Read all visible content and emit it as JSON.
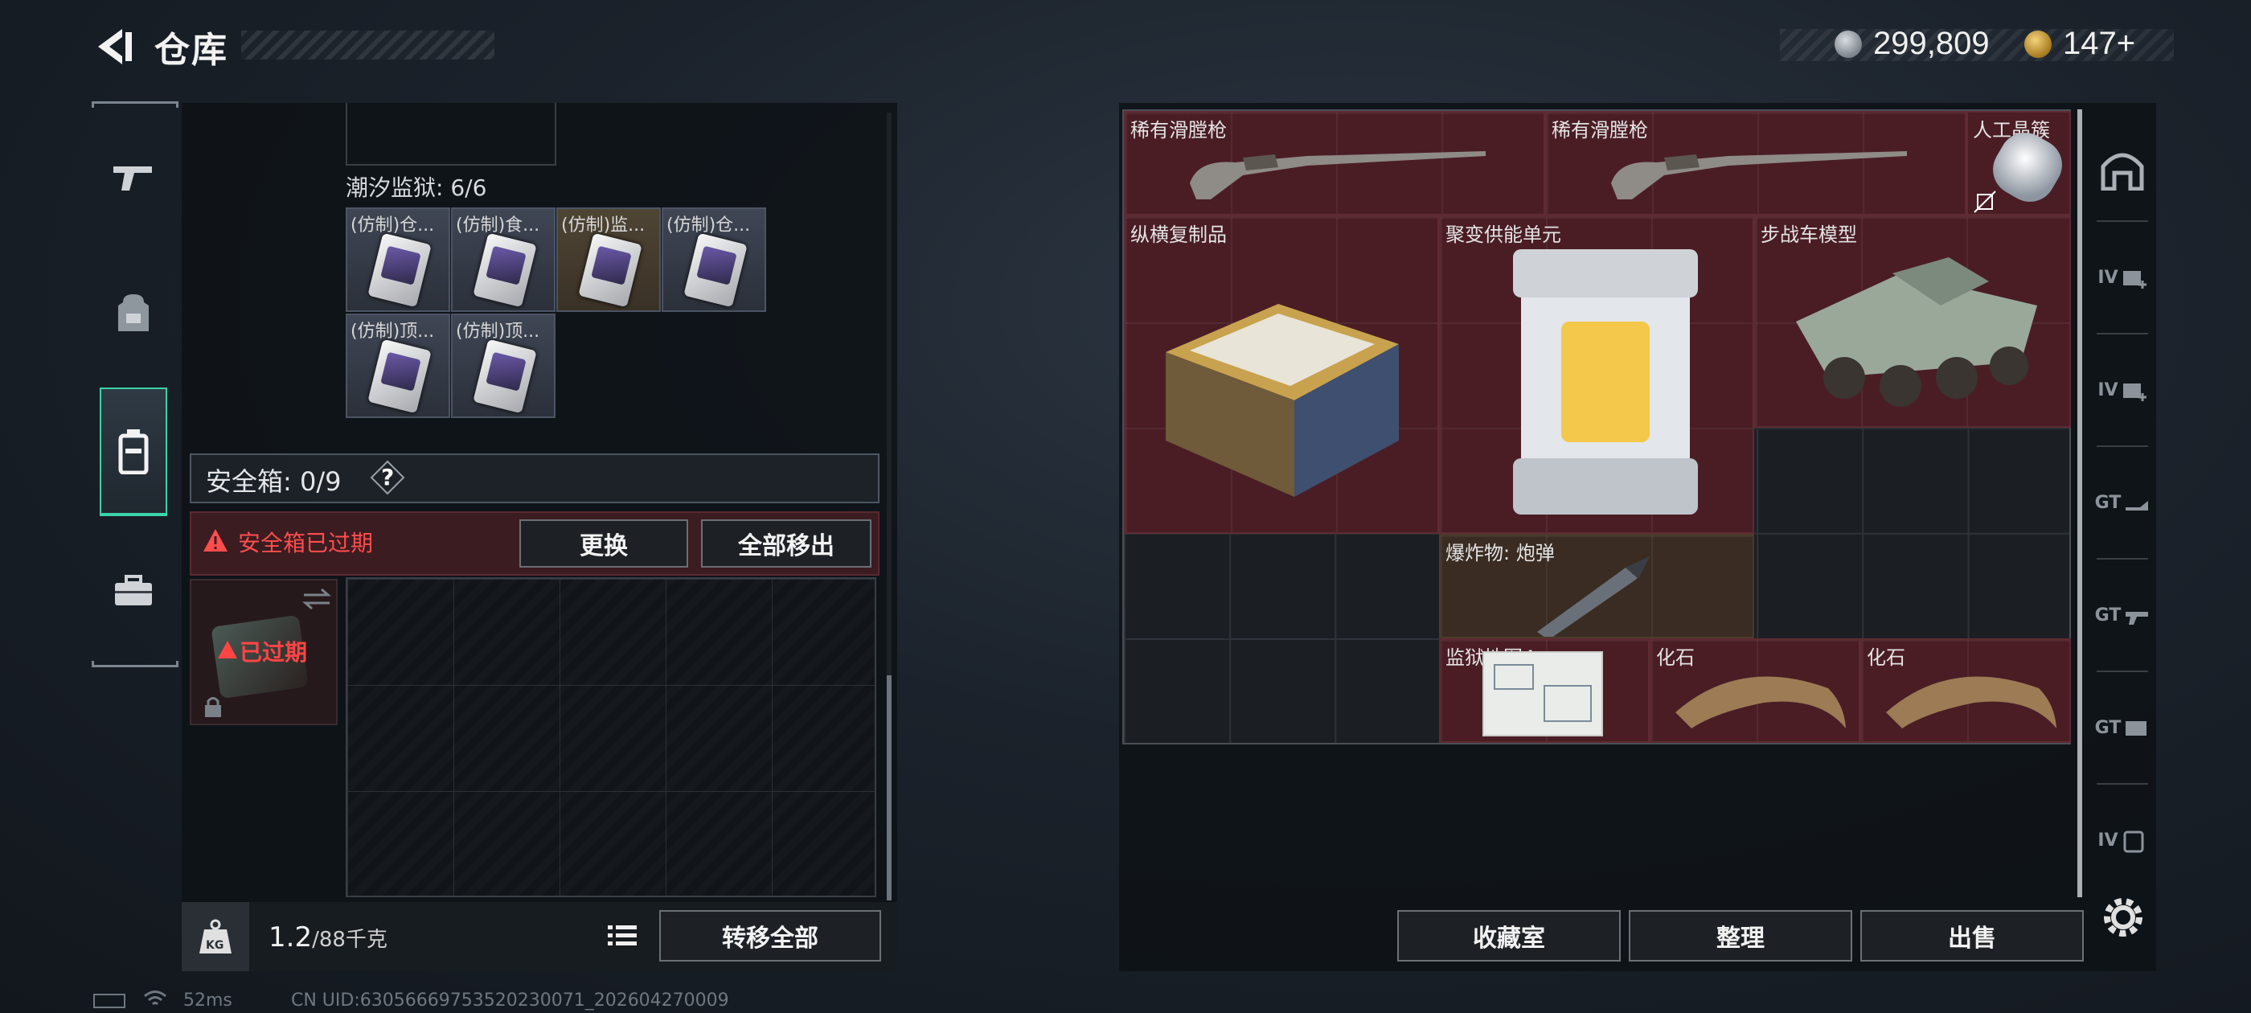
{
  "header": {
    "title": "仓库",
    "currency_silver": "299,809",
    "currency_gold": "147+"
  },
  "left": {
    "prison_title": "潮汐监狱: 6/6",
    "items": [
      {
        "label": "(仿制)仓..."
      },
      {
        "label": "(仿制)食..."
      },
      {
        "label": "(仿制)监..."
      },
      {
        "label": "(仿制)仓..."
      },
      {
        "label": "(仿制)顶..."
      },
      {
        "label": "(仿制)顶..."
      }
    ],
    "safe_box": "安全箱: 0/9",
    "help": "?",
    "expired_warning": "安全箱已过期",
    "replace_button": "更换",
    "move_all_button": "全部移出",
    "case_expired_label": "已过期",
    "weight_value": "1.2",
    "weight_max": "/88千克",
    "kg_badge": "KG",
    "transfer_all_button": "转移全部"
  },
  "right": {
    "cells": [
      {
        "label": "稀有滑膛枪"
      },
      {
        "label": "稀有滑膛枪"
      },
      {
        "label": "人工晶簇"
      },
      {
        "label": "纵横复制品"
      },
      {
        "label": "聚变供能单元"
      },
      {
        "label": "步战车模型"
      },
      {
        "label": "爆炸物: 炮弹"
      },
      {
        "label": "监狱地图4"
      },
      {
        "label": "化石"
      },
      {
        "label": "化石"
      }
    ],
    "collection_button": "收藏室",
    "sort_button": "整理",
    "sell_button": "出售",
    "side_tabs": [
      "IV",
      "IV",
      "GT",
      "GT",
      "GT",
      "IV"
    ]
  },
  "status_bar": {
    "ping": "52ms",
    "uid": "CN UID:6305666975352023007​1_202604270009"
  },
  "colors": {
    "accent": "#3bd3a7",
    "danger": "#ff4d4d",
    "item_bg": "#4a1d25"
  }
}
